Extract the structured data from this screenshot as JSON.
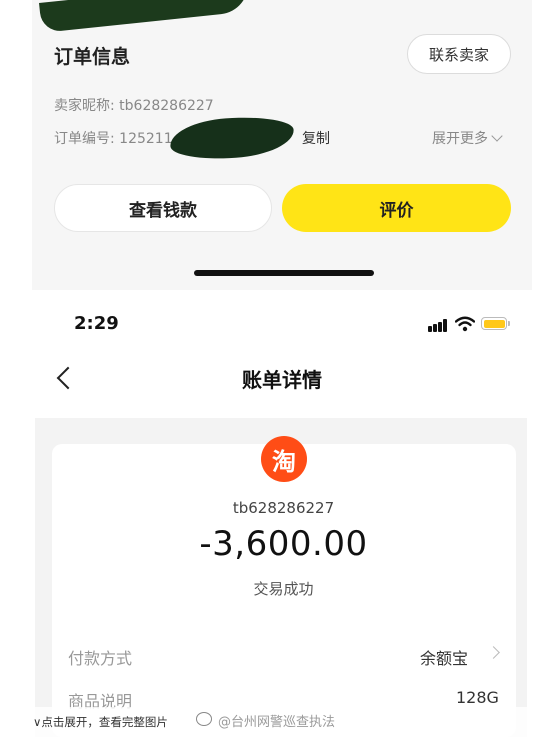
{
  "order": {
    "title": "订单信息",
    "contact_button": "联系卖家",
    "seller_label": "卖家昵称: tb628286227",
    "order_number_label": "订单编号: 125211",
    "copy": "复制",
    "expand_more": "展开更多",
    "view_payment_button": "查看钱款",
    "review_button": "评价"
  },
  "status_bar": {
    "time": "2:29",
    "battery_color": "#ffc81a"
  },
  "nav": {
    "title": "账单详情",
    "back_icon": "chevron-left-icon"
  },
  "bill": {
    "logo_text": "淘",
    "logo_color": "#ff4d16",
    "account": "tb628286227",
    "amount": "-3,600.00",
    "status": "交易成功",
    "rows": [
      {
        "label": "付款方式",
        "value": "余额宝"
      },
      {
        "label": "商品说明",
        "value": "128G"
      }
    ]
  },
  "caption": {
    "expand_text": "∨点击展开，查看完整图片",
    "watermark": "@台州网警巡查执法"
  },
  "colors": {
    "review_button": "#ffe416"
  }
}
